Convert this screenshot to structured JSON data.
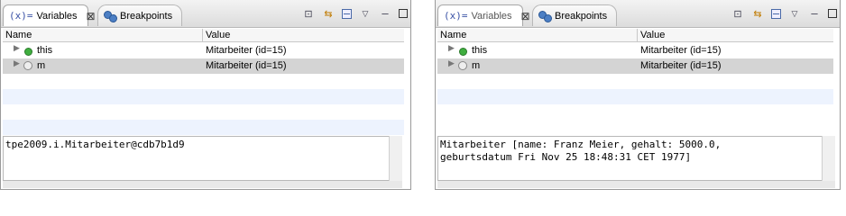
{
  "left": {
    "tabs": [
      {
        "icon_text": "(x)=",
        "label": "Variables",
        "close": "⊠"
      },
      {
        "label": "Breakpoints"
      }
    ],
    "columns": [
      "Name",
      "Value"
    ],
    "rows": [
      {
        "name": "this",
        "value": "Mitarbeiter  (id=15)",
        "icon": "green-dot-icon"
      },
      {
        "name": "m",
        "value": "Mitarbeiter  (id=15)",
        "icon": "field-icon",
        "selected": true
      }
    ],
    "detail_text": "tpe2009.i.Mitarbeiter@cdb7b1d9"
  },
  "right": {
    "tabs": [
      {
        "icon_text": "(x)=",
        "label": "Variables",
        "close": "⊠"
      },
      {
        "label": "Breakpoints"
      }
    ],
    "columns": [
      "Name",
      "Value"
    ],
    "rows": [
      {
        "name": "this",
        "value": "Mitarbeiter  (id=15)",
        "icon": "green-dot-icon"
      },
      {
        "name": "m",
        "value": "Mitarbeiter  (id=15)",
        "icon": "field-icon",
        "selected": true
      }
    ],
    "detail_text": "Mitarbeiter [name: Franz Meier, gehalt: 5000.0,\ngeburtsdatum Fri Nov 25 18:48:31 CET 1977]"
  },
  "icons": {
    "toolbar": [
      "show-type-names-icon",
      "show-logical-structure-icon",
      "collapse-all-icon",
      "view-menu-icon",
      "minimize-icon",
      "maximize-icon"
    ],
    "toolbar_glyphs": [
      "⊡",
      "⇆",
      "",
      "▽",
      "–",
      ""
    ]
  }
}
